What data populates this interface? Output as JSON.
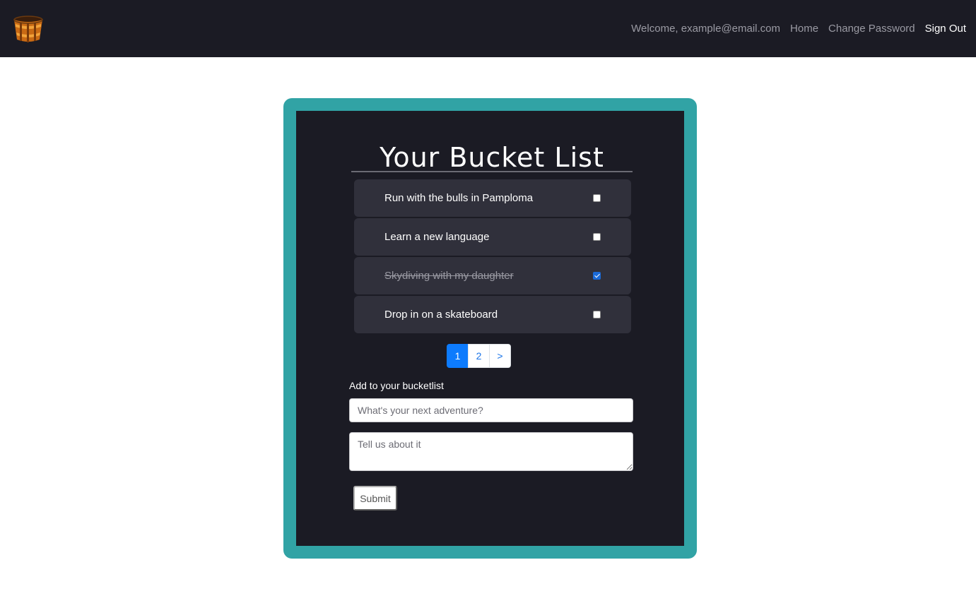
{
  "navbar": {
    "logo_icon": "bucket-icon",
    "welcome_text": "Welcome, example@email.com",
    "links": {
      "home": "Home",
      "change_password": "Change Password",
      "sign_out": "Sign Out"
    }
  },
  "card": {
    "title": "Your Bucket List",
    "items": [
      {
        "label": "Run with the bulls in Pamploma",
        "checked": false
      },
      {
        "label": "Learn a new language",
        "checked": false
      },
      {
        "label": "Skydiving with my daughter",
        "checked": true
      },
      {
        "label": "Drop in on a skateboard",
        "checked": false
      }
    ],
    "pagination": {
      "pages": [
        "1",
        "2",
        ">"
      ],
      "active": "1"
    },
    "form": {
      "label": "Add to your bucketlist",
      "title_placeholder": "What's your next adventure?",
      "description_placeholder": "Tell us about it",
      "submit_label": "Submit"
    }
  },
  "colors": {
    "navbar_bg": "#1b1b24",
    "card_border": "#31a3a5",
    "card_bg": "#1b1b24",
    "item_bg": "#30303b",
    "pagination_active": "#0d7bfd"
  }
}
